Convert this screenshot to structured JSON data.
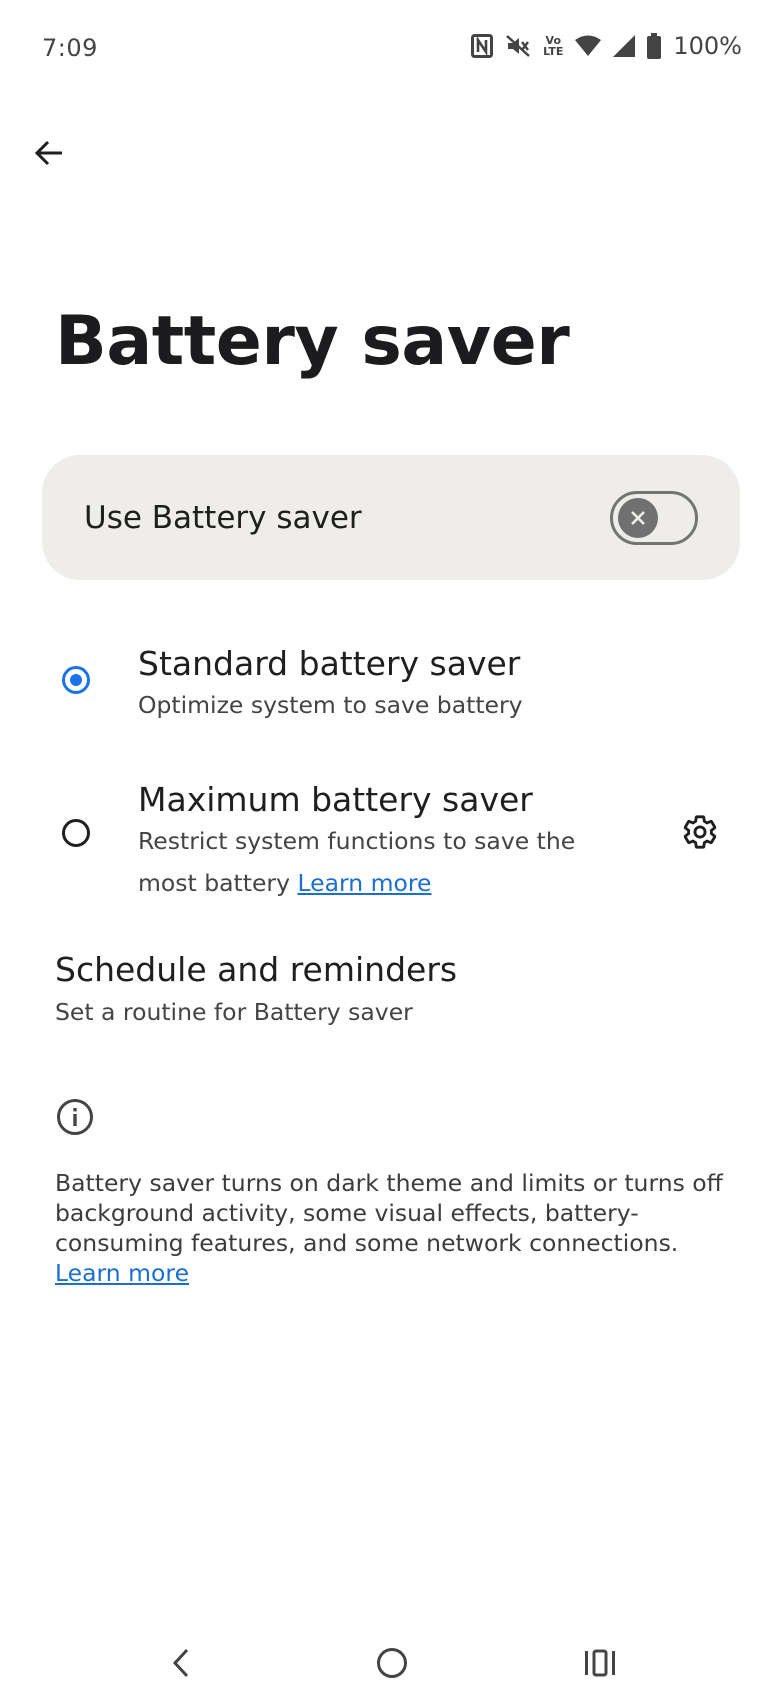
{
  "status_bar": {
    "time": "7:09",
    "battery_percent": "100%",
    "icons": [
      "nfc-icon",
      "mute-icon",
      "volte-icon",
      "wifi-icon",
      "cell-signal-icon",
      "battery-icon"
    ],
    "volte_line1": "Vo",
    "volte_line2": "LTE"
  },
  "header": {
    "back_icon": "arrow-back-icon",
    "title": "Battery saver"
  },
  "main_switch": {
    "label": "Use Battery saver",
    "enabled": false
  },
  "options": [
    {
      "title": "Standard battery saver",
      "summary": "Optimize system to save battery",
      "selected": true
    },
    {
      "title": "Maximum battery saver",
      "summary": "Restrict system functions to save the most battery",
      "link": "Learn more",
      "selected": false,
      "settings_icon": "gear-icon"
    }
  ],
  "schedule": {
    "title": "Schedule and reminders",
    "summary": "Set a routine for Battery saver"
  },
  "footer": {
    "icon": "info-icon",
    "text": "Battery saver turns on dark theme and limits or turns off background activity, some visual effects, battery-consuming features, and some network connections.",
    "link": "Learn more"
  },
  "nav_bar": {
    "back": "nav-back-icon",
    "home": "nav-home-icon",
    "recents": "nav-recents-icon"
  },
  "colors": {
    "accent": "#1a73e8",
    "card_bg": "#efedea",
    "link": "#1a6fd1"
  }
}
